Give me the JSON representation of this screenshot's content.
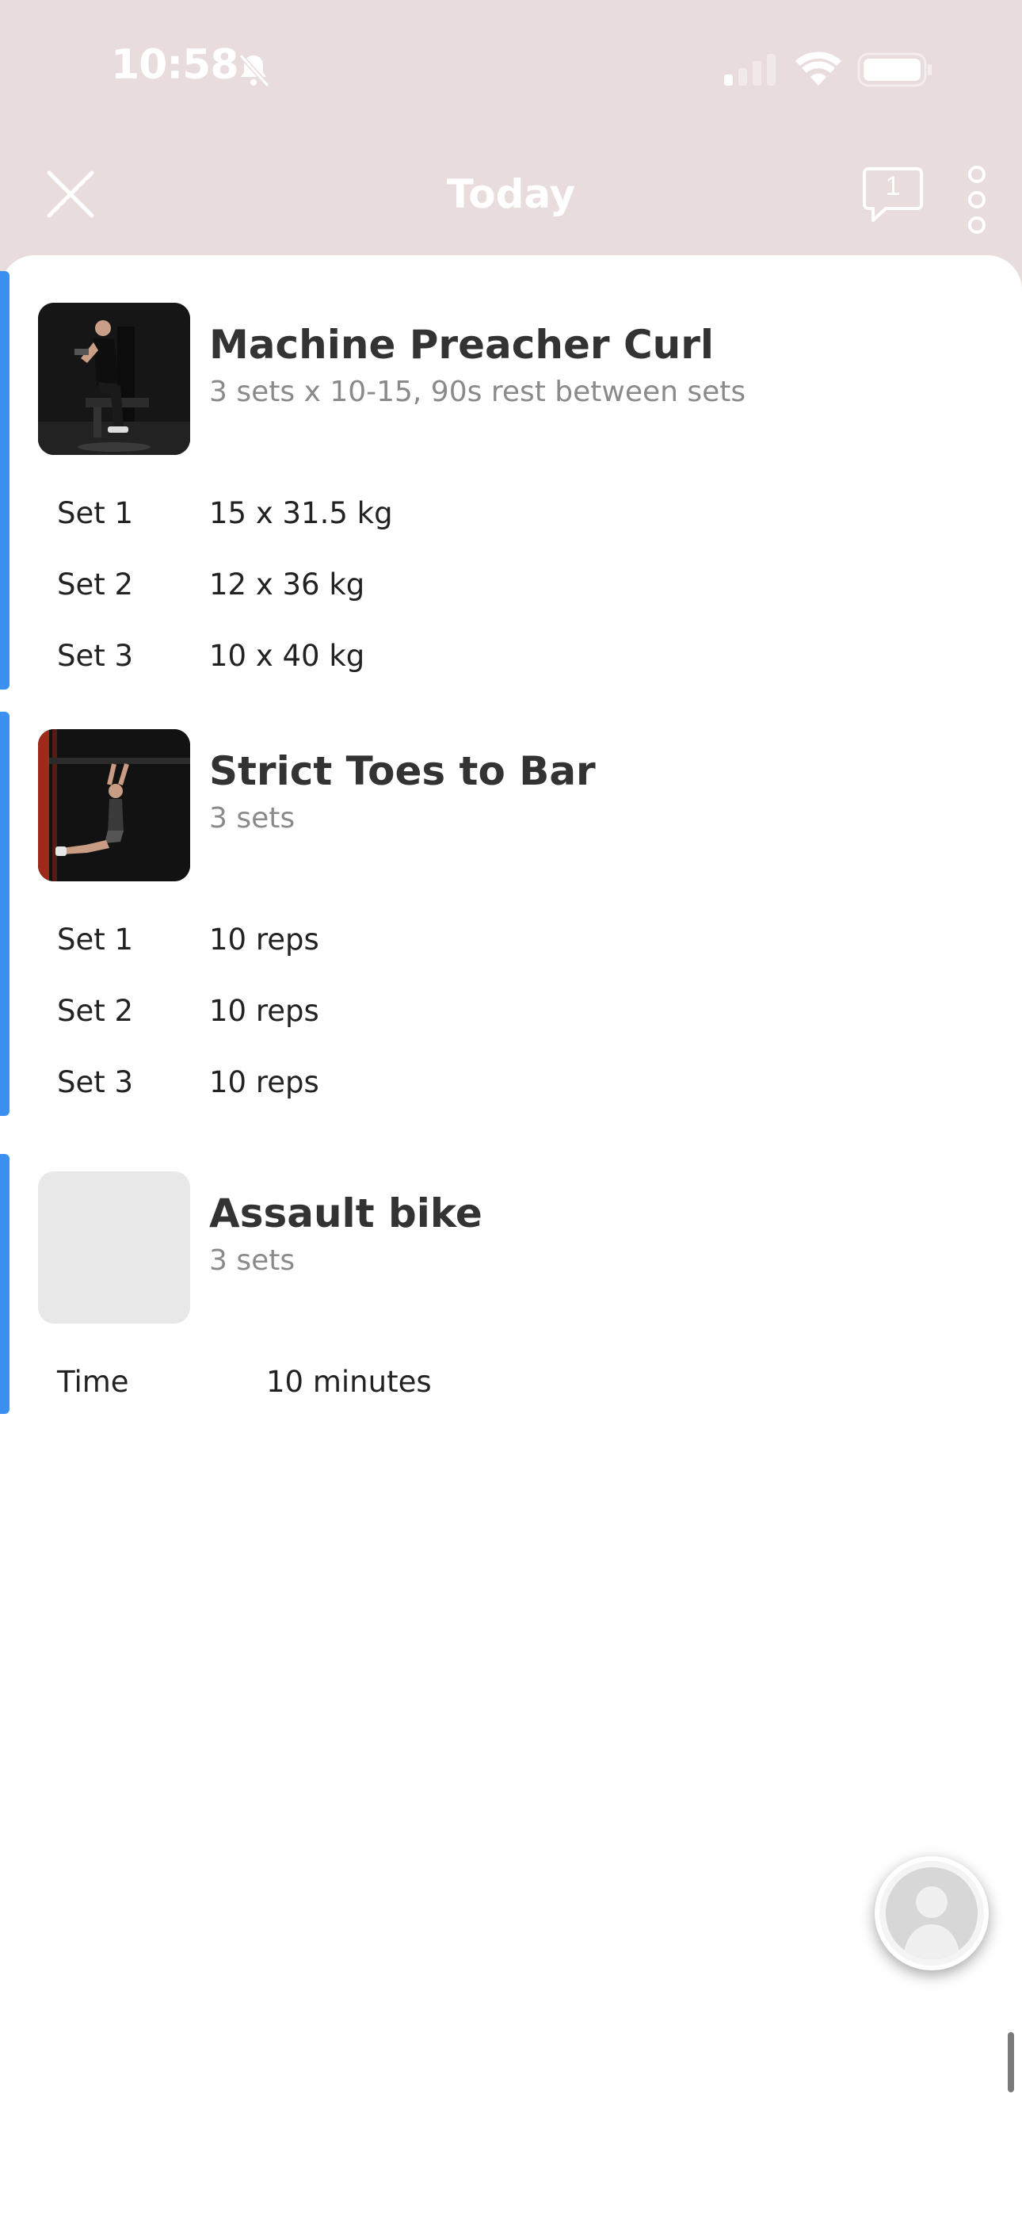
{
  "status_bar": {
    "time": "10:58",
    "icons": [
      "bell-slash-icon",
      "cellular-signal-icon",
      "wifi-icon",
      "battery-icon"
    ]
  },
  "header": {
    "title": "Today",
    "comment_count": "1",
    "icons": [
      "close-icon",
      "comment-icon",
      "more-vertical-icon"
    ]
  },
  "exercises": [
    {
      "name": "Machine Preacher Curl",
      "subtitle": "3 sets x 10-15, 90s rest between sets",
      "sets": [
        {
          "label": "Set 1",
          "value": "15 x 31.5 kg"
        },
        {
          "label": "Set 2",
          "value": "12 x 36 kg"
        },
        {
          "label": "Set 3",
          "value": "10 x 40 kg"
        }
      ]
    },
    {
      "name": "Strict Toes to Bar",
      "subtitle": "3 sets",
      "sets": [
        {
          "label": "Set 1",
          "value": "10 reps"
        },
        {
          "label": "Set 2",
          "value": "10 reps"
        },
        {
          "label": "Set 3",
          "value": "10 reps"
        }
      ]
    },
    {
      "name": "Assault bike",
      "subtitle": "3 sets",
      "sets": [
        {
          "label": "Time",
          "value": "10 minutes"
        }
      ]
    }
  ],
  "colors": {
    "header_background": "#e8dcdc",
    "accent": "#3b8ff0",
    "sheet_background": "#ffffff"
  }
}
